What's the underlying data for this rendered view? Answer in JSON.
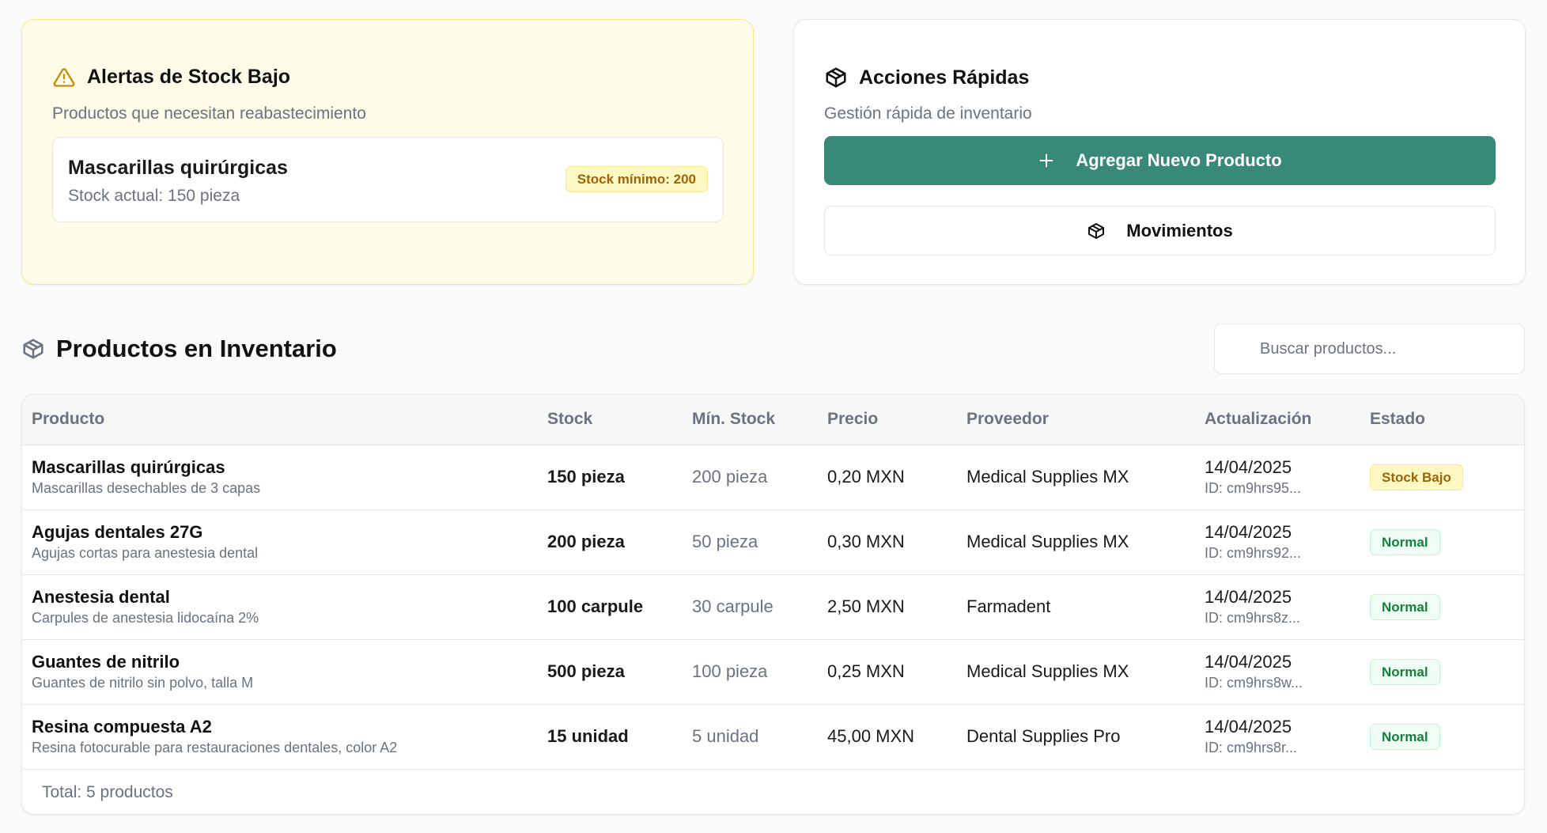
{
  "alerts": {
    "title": "Alertas de Stock Bajo",
    "subtitle": "Productos que necesitan reabastecimiento",
    "item": {
      "name": "Mascarillas quirúrgicas",
      "stock": "Stock actual: 150 pieza",
      "badge": "Stock mínimo: 200"
    },
    "icon": "warning-triangle-icon"
  },
  "quick_actions": {
    "title": "Acciones Rápidas",
    "subtitle": "Gestión rápida de inventario",
    "add_button": "Agregar Nuevo Producto",
    "movements_button": "Movimientos",
    "icon": "package-icon"
  },
  "inventory": {
    "title": "Productos en Inventario",
    "search_placeholder": "Buscar productos...",
    "columns": [
      "Producto",
      "Stock",
      "Mín. Stock",
      "Precio",
      "Proveedor",
      "Actualización",
      "Estado"
    ],
    "rows": [
      {
        "name": "Mascarillas quirúrgicas",
        "desc": "Mascarillas desechables de 3 capas",
        "stock": "150 pieza",
        "min": "200 pieza",
        "price": "0,20 MXN",
        "supplier": "Medical Supplies MX",
        "date": "14/04/2025",
        "id": "ID: cm9hrs95...",
        "status": "Stock Bajo"
      },
      {
        "name": "Agujas dentales 27G",
        "desc": "Agujas cortas para anestesia dental",
        "stock": "200 pieza",
        "min": "50 pieza",
        "price": "0,30 MXN",
        "supplier": "Medical Supplies MX",
        "date": "14/04/2025",
        "id": "ID: cm9hrs92...",
        "status": "Normal"
      },
      {
        "name": "Anestesia dental",
        "desc": "Carpules de anestesia lidocaína 2%",
        "stock": "100 carpule",
        "min": "30 carpule",
        "price": "2,50 MXN",
        "supplier": "Farmadent",
        "date": "14/04/2025",
        "id": "ID: cm9hrs8z...",
        "status": "Normal"
      },
      {
        "name": "Guantes de nitrilo",
        "desc": "Guantes de nitrilo sin polvo, talla M",
        "stock": "500 pieza",
        "min": "100 pieza",
        "price": "0,25 MXN",
        "supplier": "Medical Supplies MX",
        "date": "14/04/2025",
        "id": "ID: cm9hrs8w...",
        "status": "Normal"
      },
      {
        "name": "Resina compuesta A2",
        "desc": "Resina fotocurable para restauraciones dentales, color A2",
        "stock": "15 unidad",
        "min": "5 unidad",
        "price": "45,00 MXN",
        "supplier": "Dental Supplies Pro",
        "date": "14/04/2025",
        "id": "ID: cm9hrs8r...",
        "status": "Normal"
      }
    ],
    "total": "Total: 5 productos"
  },
  "colors": {
    "primary": "#388a76",
    "alert_bg": "#fefce8",
    "warn_badge": "#a16207",
    "ok_badge": "#15803d"
  }
}
